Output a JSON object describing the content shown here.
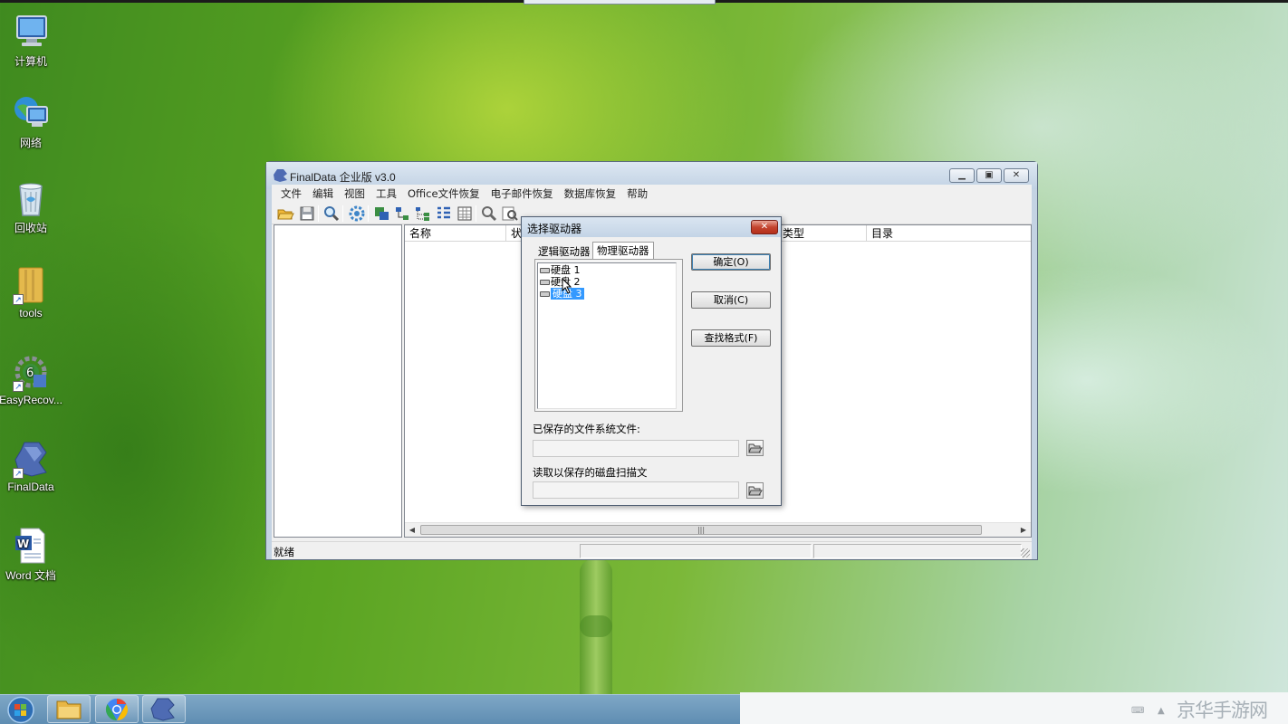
{
  "desktop": {
    "icons": [
      {
        "label": "计算机"
      },
      {
        "label": "网络"
      },
      {
        "label": "回收站"
      },
      {
        "label": "tools"
      },
      {
        "label": "EasyRecov..."
      },
      {
        "label": "FinalData"
      },
      {
        "label": "Word 文档"
      }
    ]
  },
  "window": {
    "title": "FinalData 企业版 v3.0",
    "menu": [
      "文件",
      "编辑",
      "视图",
      "工具",
      "Office文件恢复",
      "电子邮件恢复",
      "数据库恢复",
      "帮助"
    ],
    "columns": [
      "名称",
      "状",
      "类型",
      "目录"
    ],
    "status": "就绪"
  },
  "dialog": {
    "title": "选择驱动器",
    "tabs": [
      "逻辑驱动器",
      "物理驱动器"
    ],
    "drives": [
      "硬盘 1",
      "硬盘 2",
      "硬盘 3"
    ],
    "selected_drive": "硬盘 3",
    "buttons": {
      "ok": "确定(O)",
      "cancel": "取消(C)",
      "find_format": "查找格式(F)"
    },
    "saved_fs_label": "已保存的文件系统文件:",
    "read_scan_label": "读取以保存的磁盘扫描文"
  },
  "watermark": "京华手游网",
  "colors": {
    "selection": "#3399ff",
    "taskbar": "#6f9abb",
    "close_button": "#c4442f"
  }
}
